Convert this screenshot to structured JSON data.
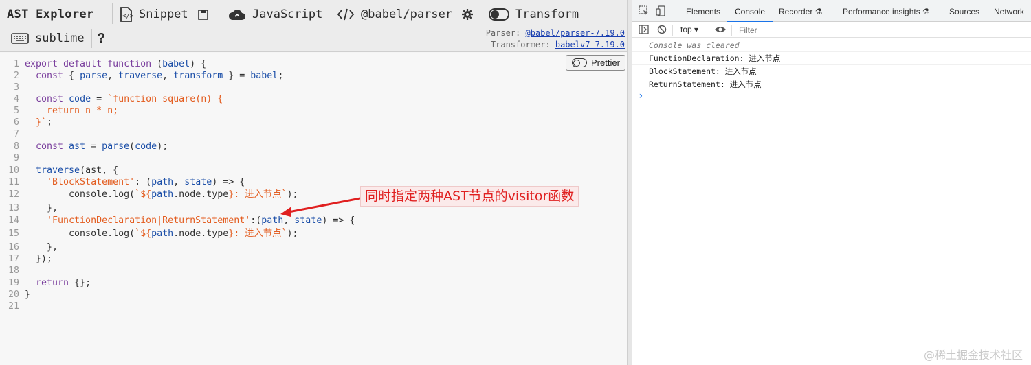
{
  "toolbar": {
    "brand": "AST Explorer",
    "snippet": "Snippet",
    "language": "JavaScript",
    "parser": "@babel/parser",
    "transform": "Transform",
    "keymap": "sublime",
    "help": "?",
    "parser_label": "Parser:",
    "parser_version": "@babel/parser-7.19.0",
    "transformer_label": "Transformer:",
    "transformer_version": "babelv7-7.19.0"
  },
  "editor": {
    "prettier_label": "Prettier",
    "line_numbers": [
      "1",
      "2",
      "3",
      "4",
      "5",
      "6",
      "7",
      "8",
      "9",
      "10",
      "11",
      "12",
      "13",
      "14",
      "15",
      "16",
      "17",
      "18",
      "19",
      "20",
      "21"
    ],
    "tokens": {
      "l1a": "export default function",
      "l1b": " (",
      "l1c": "babel",
      "l1d": ") {",
      "l2a": "  const",
      "l2b": " { ",
      "l2c": "parse",
      "l2d": ", ",
      "l2e": "traverse",
      "l2f": ", ",
      "l2g": "transform",
      "l2h": " } = ",
      "l2i": "babel",
      "l2j": ";",
      "l4a": "  const",
      "l4b": " code",
      "l4c": " = ",
      "l4d": "`function square(n) {",
      "l5a": "    return n * n;",
      "l6a": "  }`",
      "l6b": ";",
      "l8a": "  const",
      "l8b": " ast",
      "l8c": " = ",
      "l8d": "parse",
      "l8e": "(",
      "l8f": "code",
      "l8g": ");",
      "l10a": "  traverse",
      "l10b": "(ast, {",
      "l11a": "    'BlockStatement'",
      "l11b": ": (",
      "l11c": "path",
      "l11d": ", ",
      "l11e": "state",
      "l11f": ") => {",
      "l12a": "        console.log(",
      "l12b": "`${",
      "l12c": "path",
      "l12d": ".node.type",
      "l12e": "}: 进入节点`",
      "l12f": ");",
      "l13a": "    },",
      "l14a": "    'FunctionDeclaration|ReturnStatement'",
      "l14b": ":(",
      "l14c": "path",
      "l14d": ", ",
      "l14e": "state",
      "l14f": ") => {",
      "l15a": "        console.log(",
      "l15b": "`${",
      "l15c": "path",
      "l15d": ".node.type",
      "l15e": "}: 进入节点`",
      "l15f": ");",
      "l16a": "    },",
      "l17a": "  });",
      "l19a": "  return",
      "l19b": " {};",
      "l20a": "}"
    }
  },
  "annotation": "同时指定两种AST节点的visitor函数",
  "devtools": {
    "tabs": [
      "Elements",
      "Console",
      "Recorder ⚗",
      "Performance insights ⚗",
      "Sources",
      "Network"
    ],
    "active_tab": "Console",
    "context": "top ▾",
    "filter_placeholder": "Filter",
    "logs": [
      "Console was cleared",
      "FunctionDeclaration: 进入节点",
      "BlockStatement: 进入节点",
      "ReturnStatement: 进入节点"
    ],
    "prompt": "›"
  },
  "watermark": "@稀土掘金技术社区",
  "colors": {
    "keyword": "#7a3e9d",
    "identifier": "#1c4fa8",
    "string": "#e35d20",
    "annotation_red": "#e02020",
    "active_tab_underline": "#1a73e8"
  }
}
